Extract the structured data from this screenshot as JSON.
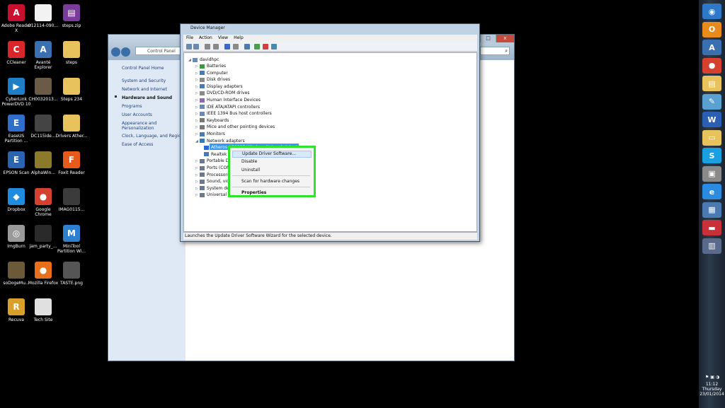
{
  "desktop": {
    "icons": [
      {
        "label": "Adobe Reader X",
        "icon": "adobe-reader-icon",
        "color": "#c8102e",
        "glyph": "A"
      },
      {
        "label": "012114-090...",
        "icon": "document-file-icon",
        "color": "#f2f2f2",
        "glyph": ""
      },
      {
        "label": "steps.zip",
        "icon": "winrar-archive-icon",
        "color": "#7a3b9a",
        "glyph": "▤"
      },
      {
        "label": "CCleaner",
        "icon": "ccleaner-icon",
        "color": "#d9262b",
        "glyph": "C"
      },
      {
        "label": "Avanté Explorer",
        "icon": "avante-explorer-icon",
        "color": "#3a6fb0",
        "glyph": "A"
      },
      {
        "label": "steps",
        "icon": "folder-icon",
        "color": "#e8c25c",
        "glyph": ""
      },
      {
        "label": "CyberLink PowerDVD 10",
        "icon": "powerdvd-icon",
        "color": "#1f7fc6",
        "glyph": "▶"
      },
      {
        "label": "CH0032013...",
        "icon": "image-file-icon",
        "color": "#6b5a45",
        "glyph": ""
      },
      {
        "label": "Steps 234",
        "icon": "folder-icon",
        "color": "#e8c25c",
        "glyph": ""
      },
      {
        "label": "EaseUS Partition ...",
        "icon": "easeus-partition-icon",
        "color": "#2f6fc9",
        "glyph": "E"
      },
      {
        "label": "DC115ide...",
        "icon": "image-file-icon",
        "color": "#444444",
        "glyph": ""
      },
      {
        "label": "Drivers Ather...",
        "icon": "folder-icon",
        "color": "#e8c25c",
        "glyph": ""
      },
      {
        "label": "EPSON Scan",
        "icon": "epson-scan-icon",
        "color": "#2a63b0",
        "glyph": "E"
      },
      {
        "label": "AlphaWin...",
        "icon": "image-file-icon",
        "color": "#8a7a2a",
        "glyph": ""
      },
      {
        "label": "Foxit Reader",
        "icon": "foxit-reader-icon",
        "color": "#e65a1c",
        "glyph": "F"
      },
      {
        "label": "Dropbox",
        "icon": "dropbox-icon",
        "color": "#1f8ce0",
        "glyph": "◆"
      },
      {
        "label": "Google Chrome",
        "icon": "chrome-icon",
        "color": "#d6402f",
        "glyph": "●"
      },
      {
        "label": "IMAG0115...",
        "icon": "image-file-icon",
        "color": "#3b3b3b",
        "glyph": ""
      },
      {
        "label": "ImgBurn",
        "icon": "imgburn-icon",
        "color": "#9a9a9a",
        "glyph": "◎"
      },
      {
        "label": "jam_party_...",
        "icon": "video-file-icon",
        "color": "#2a2a2a",
        "glyph": ""
      },
      {
        "label": "MiniTool Partition Wi...",
        "icon": "minitool-icon",
        "color": "#2f7fd0",
        "glyph": "M"
      },
      {
        "label": "soDogeMu...",
        "icon": "image-file-icon",
        "color": "#6a5a3a",
        "glyph": ""
      },
      {
        "label": "Mozilla Firefox",
        "icon": "firefox-icon",
        "color": "#e8701c",
        "glyph": "●"
      },
      {
        "label": "TASTE.png",
        "icon": "image-file-icon",
        "color": "#555555",
        "glyph": ""
      },
      {
        "label": "Recuva",
        "icon": "recuva-icon",
        "color": "#d8a02a",
        "glyph": "R"
      },
      {
        "label": "Tech Site",
        "icon": "document-file-icon",
        "color": "#e0e0e0",
        "glyph": ""
      }
    ]
  },
  "control_panel": {
    "address": "Control Panel",
    "search_glyph": "⌕",
    "controls": {
      "min": "_",
      "max": "□",
      "close": "x"
    },
    "sidebar": {
      "home": "Control Panel Home",
      "items": [
        "System and Security",
        "Network and Internet",
        "Hardware and Sound",
        "Programs",
        "User Accounts",
        "Appearance and Personalization",
        "Clock, Language, and Region",
        "Ease of Access"
      ]
    }
  },
  "device_manager": {
    "title": "Device Manager",
    "menu": [
      "File",
      "Action",
      "View",
      "Help"
    ],
    "tree": {
      "root": "davidhpc",
      "nodes": [
        "Batteries",
        "Computer",
        "Disk drives",
        "Display adapters",
        "DVD/CD-ROM drives",
        "Human Interface Devices",
        "IDE ATA/ATAPI controllers",
        "IEEE 1394 Bus host controllers",
        "Keyboards",
        "Mice and other pointing devices",
        "Monitors",
        "Network adapters"
      ],
      "network_children": [
        "Atheros AR9285 Wireless Network Adapter",
        "Realtek PCIe FE Family Controller NIC (NDIS 6.20)"
      ],
      "after_nodes": [
        "Portable D",
        "Ports (COM",
        "Processors",
        "Sound, vid",
        "System de",
        "Universal S"
      ]
    },
    "status": "Launches the Update Driver Software Wizard for the selected device."
  },
  "context_menu": {
    "update": "Update Driver Software...",
    "disable": "Disable",
    "uninstall": "Uninstall",
    "scan": "Scan for hardware changes",
    "properties": "Properties",
    "highlight_color": "#2ee22e"
  },
  "taskbar": {
    "buttons": [
      {
        "icon": "start-orb-icon",
        "color": "#2f77c9",
        "glyph": "◉"
      },
      {
        "icon": "outlook-icon",
        "color": "#e88a1c",
        "glyph": "O"
      },
      {
        "icon": "avante-icon",
        "color": "#3a6fb0",
        "glyph": "A"
      },
      {
        "icon": "chrome-icon",
        "color": "#d6402f",
        "glyph": "●"
      },
      {
        "icon": "explorer-folder-icon",
        "color": "#e8c25c",
        "glyph": "▤"
      },
      {
        "icon": "note-icon",
        "color": "#5aa0d0",
        "glyph": "✎"
      },
      {
        "icon": "word-icon",
        "color": "#2b5fb3",
        "glyph": "W"
      },
      {
        "icon": "folder-icon",
        "color": "#e8c25c",
        "glyph": "▭"
      },
      {
        "icon": "skype-icon",
        "color": "#1aa0e0",
        "glyph": "S"
      },
      {
        "icon": "device-icon",
        "color": "#8a8a8a",
        "glyph": "▣"
      },
      {
        "icon": "internet-explorer-icon",
        "color": "#2a8be0",
        "glyph": "e"
      },
      {
        "icon": "network-icon",
        "color": "#4a7ab0",
        "glyph": "▦"
      },
      {
        "icon": "control-panel-icon",
        "color": "#c8303a",
        "glyph": "▬"
      },
      {
        "icon": "device-manager-icon",
        "color": "#5a6a8a",
        "glyph": "▥"
      }
    ],
    "time": "11:12",
    "day": "Thursday",
    "date": "23/01/2014"
  }
}
